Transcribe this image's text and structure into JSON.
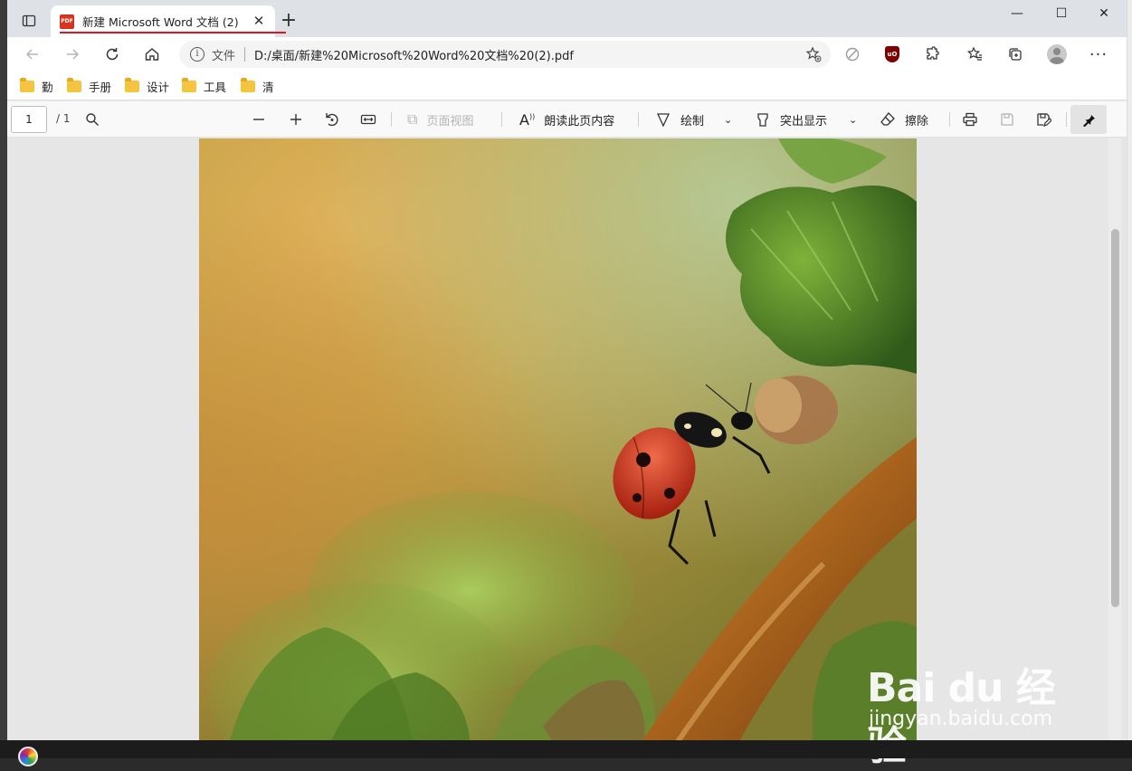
{
  "browser": {
    "tab": {
      "title": "新建 Microsoft Word 文档 (2).pdf",
      "favicon_label": "PDF",
      "close_glyph": "✕"
    },
    "new_tab_glyph": "+",
    "window_controls": {
      "minimize": "—",
      "maximize": "☐",
      "close": "✕"
    },
    "address": {
      "scheme_label": "文件",
      "url": "D:/桌面/新建%20Microsoft%20Word%20文档%20(2).pdf"
    },
    "extensions": {
      "ublock_label": "uO"
    },
    "bookmarks": [
      "勤",
      "手册",
      "设计",
      "工具",
      "清"
    ]
  },
  "pdf_toolbar": {
    "page_current": "1",
    "page_total": "/ 1",
    "page_view_label": "页面视图",
    "read_aloud_label": "朗读此页内容",
    "draw_label": "绘制",
    "highlight_label": "突出显示",
    "erase_label": "擦除"
  },
  "watermark": {
    "logo": "Bai du 经验",
    "sub": "jingyan.baidu.com"
  },
  "colors": {
    "tab_underline": "#e81123",
    "tab_bar": "#dee1e6",
    "viewer_bg": "#e6e6e6",
    "accent_red": "#e81123"
  },
  "icons": [
    "sidebar-toggle-icon",
    "pdf-icon",
    "back-arrow-icon",
    "forward-arrow-icon",
    "refresh-icon",
    "home-icon",
    "info-icon",
    "add-favorite-icon",
    "tracking-icon",
    "ublock-icon",
    "puzzle-extension-icon",
    "favorites-icon",
    "collections-icon",
    "profile-icon",
    "more-icon",
    "search-icon",
    "zoom-out-icon",
    "zoom-in-icon",
    "rotate-icon",
    "fit-width-icon",
    "page-view-icon",
    "read-aloud-icon",
    "draw-icon",
    "highlight-icon",
    "erase-icon",
    "print-icon",
    "save-icon",
    "save-as-icon",
    "pin-icon"
  ]
}
